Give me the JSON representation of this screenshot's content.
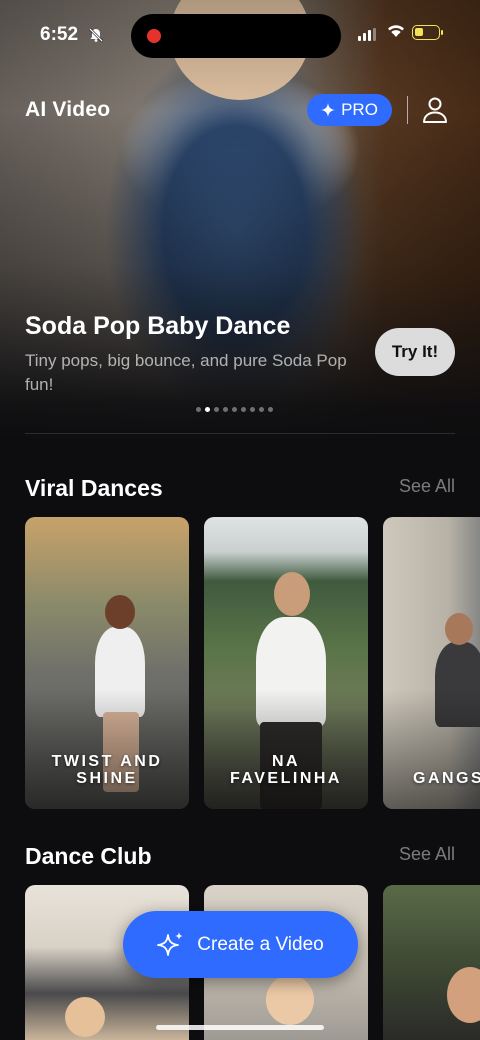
{
  "status_bar": {
    "time": "6:52"
  },
  "header": {
    "title": "AI Video",
    "pro_label": "PRO"
  },
  "hero": {
    "title": "Soda Pop Baby Dance",
    "subtitle": "Tiny pops, big bounce, and pure Soda Pop fun!",
    "cta_label": "Try It!",
    "page_count": 9,
    "active_page": 2
  },
  "sections": [
    {
      "title": "Viral Dances",
      "see_all": "See All",
      "cards": [
        {
          "label": "TWIST AND SHINE"
        },
        {
          "label": "NA FAVELINHA"
        },
        {
          "label": "GANGS"
        }
      ]
    },
    {
      "title": "Dance Club",
      "see_all": "See All",
      "cards": [
        {
          "label": ""
        },
        {
          "label": ""
        },
        {
          "label": ""
        }
      ]
    }
  ],
  "fab": {
    "label": "Create a Video",
    "icon": "sparkles-icon"
  },
  "colors": {
    "accent": "#2f6bff",
    "background": "#0d0d0f",
    "battery": "#f2e25b"
  }
}
